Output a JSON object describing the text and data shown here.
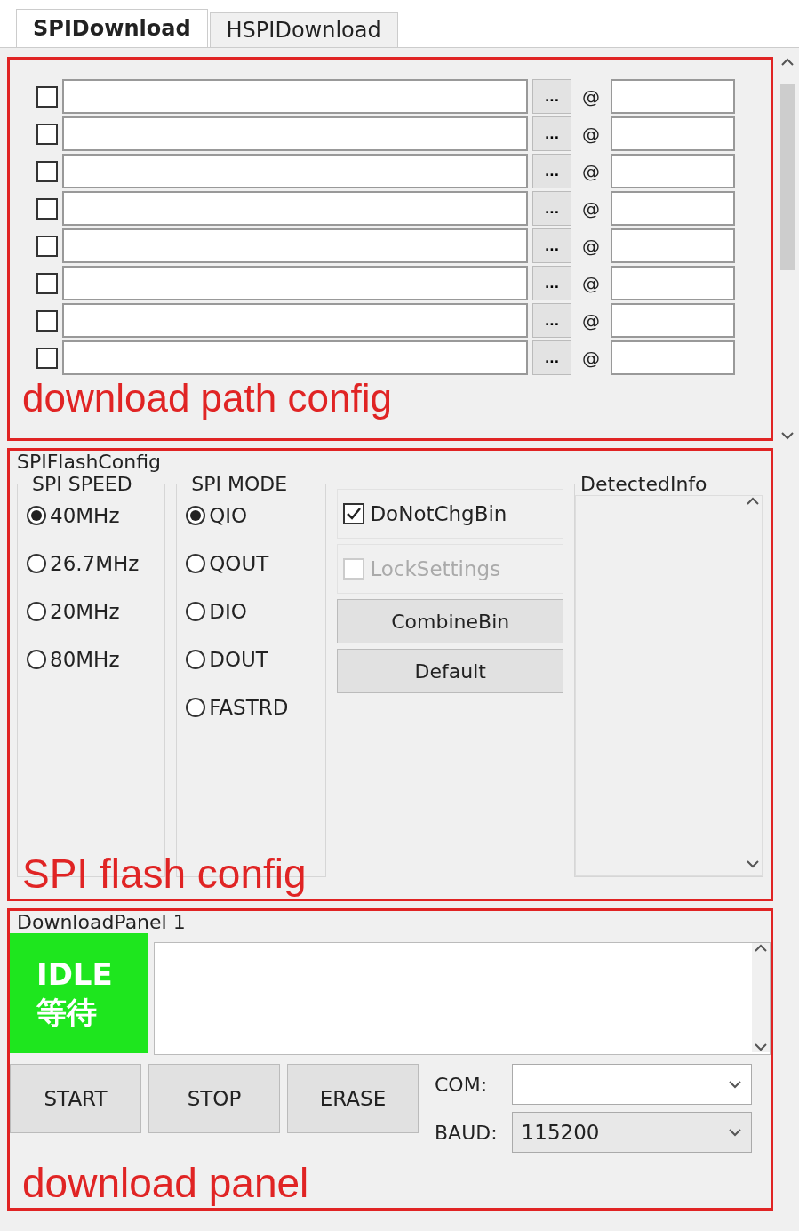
{
  "tabs": [
    {
      "label": "SPIDownload",
      "selected": true
    },
    {
      "label": "HSPIDownload",
      "selected": false
    }
  ],
  "path_config": {
    "annotation": "download path config",
    "rows": [
      {
        "checked": false,
        "browse": "...",
        "at": "@"
      },
      {
        "checked": false,
        "browse": "...",
        "at": "@"
      },
      {
        "checked": false,
        "browse": "...",
        "at": "@"
      },
      {
        "checked": false,
        "browse": "...",
        "at": "@"
      },
      {
        "checked": false,
        "browse": "...",
        "at": "@"
      },
      {
        "checked": false,
        "browse": "...",
        "at": "@"
      },
      {
        "checked": false,
        "browse": "...",
        "at": "@"
      },
      {
        "checked": false,
        "browse": "...",
        "at": "@"
      }
    ]
  },
  "flash_config": {
    "title": "SPIFlashConfig",
    "annotation": "SPI flash config",
    "speed": {
      "title": "SPI SPEED",
      "options": [
        {
          "label": "40MHz",
          "selected": true
        },
        {
          "label": "26.7MHz",
          "selected": false
        },
        {
          "label": "20MHz",
          "selected": false
        },
        {
          "label": "80MHz",
          "selected": false
        }
      ]
    },
    "mode": {
      "title": "SPI MODE",
      "options": [
        {
          "label": "QIO",
          "selected": true
        },
        {
          "label": "QOUT",
          "selected": false
        },
        {
          "label": "DIO",
          "selected": false
        },
        {
          "label": "DOUT",
          "selected": false
        },
        {
          "label": "FASTRD",
          "selected": false
        }
      ]
    },
    "checks": [
      {
        "label": "DoNotChgBin",
        "checked": true,
        "disabled": false
      },
      {
        "label": "LockSettings",
        "checked": false,
        "disabled": true
      }
    ],
    "buttons": [
      "CombineBin",
      "Default"
    ],
    "detected_info": {
      "title": "DetectedInfo"
    }
  },
  "download_panel": {
    "title": "DownloadPanel 1",
    "annotation": "download panel",
    "status": [
      "IDLE",
      "等待"
    ],
    "buttons": [
      "START",
      "STOP",
      "ERASE"
    ],
    "com": {
      "label": "COM:"
    },
    "baud": {
      "label": "BAUD:",
      "value": "115200"
    }
  }
}
